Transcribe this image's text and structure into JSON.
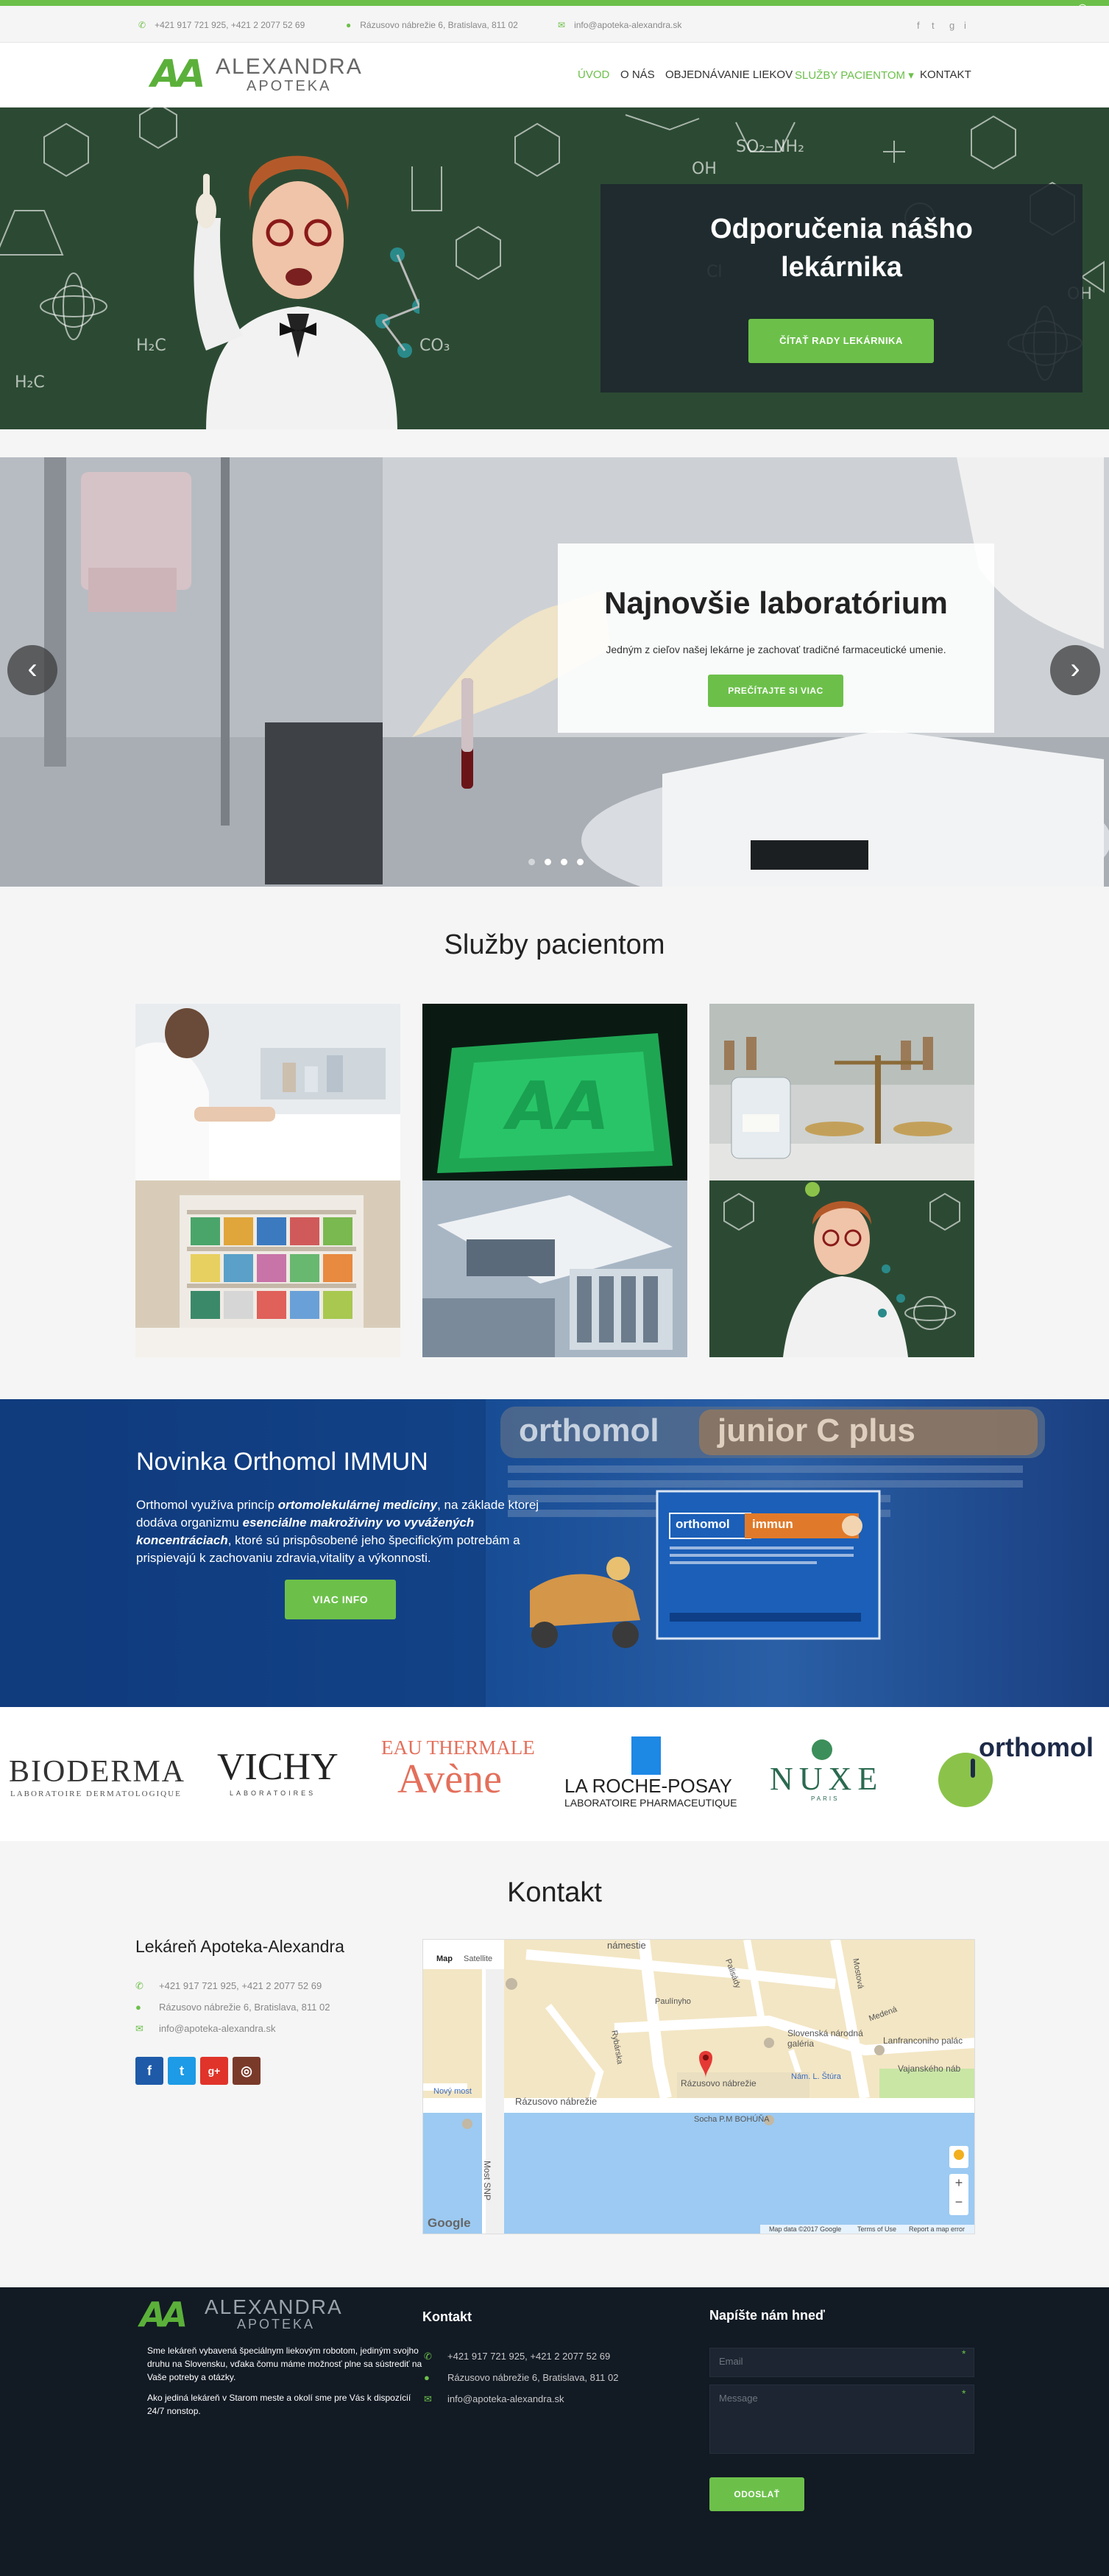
{
  "topbar": {
    "phone": "+421 917 721 925, +421 2 2077 52 69",
    "address": "Rázusovo nábrežie 6, Bratislava, 811 02",
    "email": "info@apoteka-alexandra.sk",
    "social": [
      "f",
      "t",
      "g",
      "i"
    ]
  },
  "logo": {
    "mark": "AA",
    "name": "ALEXANDRA",
    "sub": "APOTEKA"
  },
  "nav": {
    "items": [
      {
        "label": "ÚVOD",
        "active": true
      },
      {
        "label": "O NÁS",
        "active": false
      },
      {
        "label": "OBJEDNÁVANIE LIEKOV",
        "active": false
      },
      {
        "label": "SLUŽBY PACIENTOM ▾",
        "active": true
      },
      {
        "label": "KONTAKT",
        "active": false
      }
    ]
  },
  "hero": {
    "title_line1": "Odporučenia nášho",
    "title_line2": "lekárnika",
    "button": "ČÍTAŤ RADY LEKÁRNIKA"
  },
  "slider": {
    "title": "Najnovšie laboratórium",
    "subtitle": "Jedným z cieľov našej lekárne je zachovať tradičné farmaceutické umenie.",
    "button": "PREČÍTAJTE SI VIAC",
    "prev": "‹",
    "next": "›",
    "slides": 4,
    "active_slide": 1
  },
  "services": {
    "title": "Služby pacientom"
  },
  "promo": {
    "title": "Novinka Orthomol IMMUN",
    "text_1": "Orthomol využíva princíp ",
    "text_b1": "ortomolekulárnej mediciny",
    "text_2": ", na základe ktorej dodáva organizmu ",
    "text_b2": "esenciálne makroživiny vo vyvážených koncentráciach",
    "text_3": ", ktoré sú prispôsobené jeho špecifickým potrebám a prispievajú k zachovaniu zdravia,vitality a výkonnosti.",
    "button": "VIAC INFO",
    "bg_brand": "orthomol",
    "bg_product": "junior C plus",
    "box_brand": "orthomol",
    "box_product": "immun"
  },
  "brands": {
    "bioderma": "BIODERMA",
    "bioderma_sub": "LABORATOIRE DERMATOLOGIQUE",
    "vichy": "VICHY",
    "vichy_sub": "LABORATOIRES",
    "avene_top": "EAU THERMALE",
    "avene": "Avène",
    "laroche": "LA ROCHE-POSAY",
    "laroche_sub": "LABORATOIRE PHARMACEUTIQUE",
    "nuxe": "NUXE",
    "nuxe_sub": "PARIS",
    "orthomol": "orthomol"
  },
  "contact": {
    "title": "Kontakt",
    "name": "Lekáreň Apoteka-Alexandra",
    "phone": "+421 917 721 925, +421 2 2077 52 69",
    "address": "Rázusovo nábrežie 6, Bratislava, 811 02",
    "email": "info@apoteka-alexandra.sk",
    "social": [
      "f",
      "t",
      "g+",
      "◎"
    ]
  },
  "map": {
    "tab_map": "Map",
    "tab_satellite": "Satellite",
    "labels": {
      "namestie": "námestie",
      "slovenska": "Slovenská národná galéria",
      "lanfranconi": "Lanfranconiho palác",
      "vajanskeho": "Vajanského náb",
      "razusovo_1": "Rázusovo nábrežie",
      "razusovo_2": "Rázusovo nábrežie",
      "nam_stura": "Nám. L. Štúra",
      "socha": "Socha P.M BOHÚŇA",
      "novy_most": "Nový most",
      "most_snp": "Most SNP",
      "paulinyho": "Paulínyho",
      "rybarska": "Rybárska",
      "mostova": "Mostová",
      "medena": "Medená",
      "palisady": "Palisády"
    },
    "google": "Google",
    "footer_data": "Map data ©2017 Google",
    "footer_terms": "Terms of Use",
    "footer_report": "Report a map error",
    "zoom_in": "+",
    "zoom_out": "−"
  },
  "footer": {
    "about_1": "Sme lekáreň vybavená špeciálnym liekovým robotom, jediným svojho druhu na Slovensku, vďaka čomu máme možnosť plne sa sústrediť na Vaše potreby a otázky.",
    "about_2": "Ako jediná lekáreň v Starom meste a okolí sme pre Vás k dispozícií 24/7 nonstop.",
    "contact_head": "Kontakt",
    "phone": "+421 917 721 925, +421 2 2077 52 69",
    "address": "Rázusovo nábrežie 6, Bratislava, 811 02",
    "email": "info@apoteka-alexandra.sk",
    "form_head": "Napíšte nám hneď",
    "email_placeholder": "Email",
    "message_placeholder": "Message",
    "send": "ODOSLAŤ"
  },
  "colors": {
    "accent": "#6cc04a",
    "footer": "#121a24",
    "chalkboard": "#2c4a33",
    "promo": "#154a92"
  }
}
